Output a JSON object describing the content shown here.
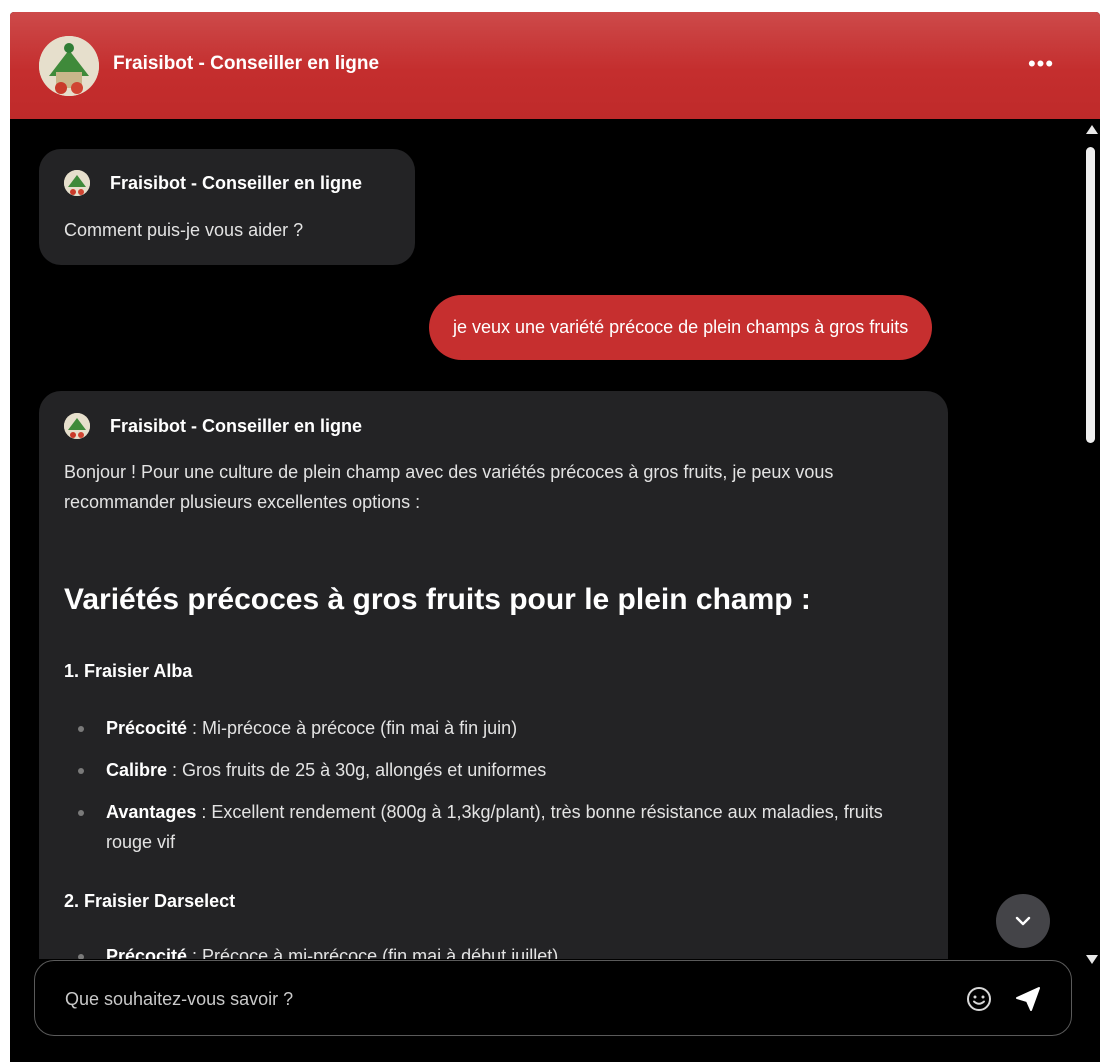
{
  "header": {
    "title": "Fraisibot - Conseiller en ligne",
    "menu_label": "•••"
  },
  "messages": {
    "greeting": {
      "bot_name": "Fraisibot - Conseiller en ligne",
      "text": "Comment puis-je vous aider ?"
    },
    "user_message": "je veux une variété précoce de plein champs à gros fruits",
    "answer": {
      "bot_name": "Fraisibot - Conseiller en ligne",
      "intro": "Bonjour ! Pour une culture de plein champ avec des variétés précoces à gros fruits, je peux vous recommander plusieurs excellentes options :",
      "heading": "Variétés précoces à gros fruits pour le plein champ :",
      "varieties": [
        {
          "title": "1. Fraisier Alba",
          "items": [
            {
              "label": "Précocité",
              "text": " : Mi-précoce à précoce (fin mai à fin juin)"
            },
            {
              "label": "Calibre",
              "text": " : Gros fruits de 25 à 30g, allongés et uniformes"
            },
            {
              "label": "Avantages",
              "text": " : Excellent rendement (800g à 1,3kg/plant), très bonne résistance aux mal­adies, fruits rouge vif"
            }
          ]
        },
        {
          "title": "2. Fraisier Darselect",
          "items": [
            {
              "label": "Précocité",
              "text": " : Précoce à mi-précoce (fin mai à début juillet)"
            }
          ]
        }
      ]
    }
  },
  "composer": {
    "placeholder": "Que souhaitez-vous savoir ?"
  },
  "colors": {
    "header_red": "#c42e2e",
    "user_bubble": "#c62f2f",
    "bot_bubble": "#232325",
    "background": "#000000"
  },
  "icons": {
    "menu": "more-horizontal-icon",
    "scroll_down": "chevron-down-icon",
    "emoji": "smiley-icon",
    "send": "send-icon"
  }
}
